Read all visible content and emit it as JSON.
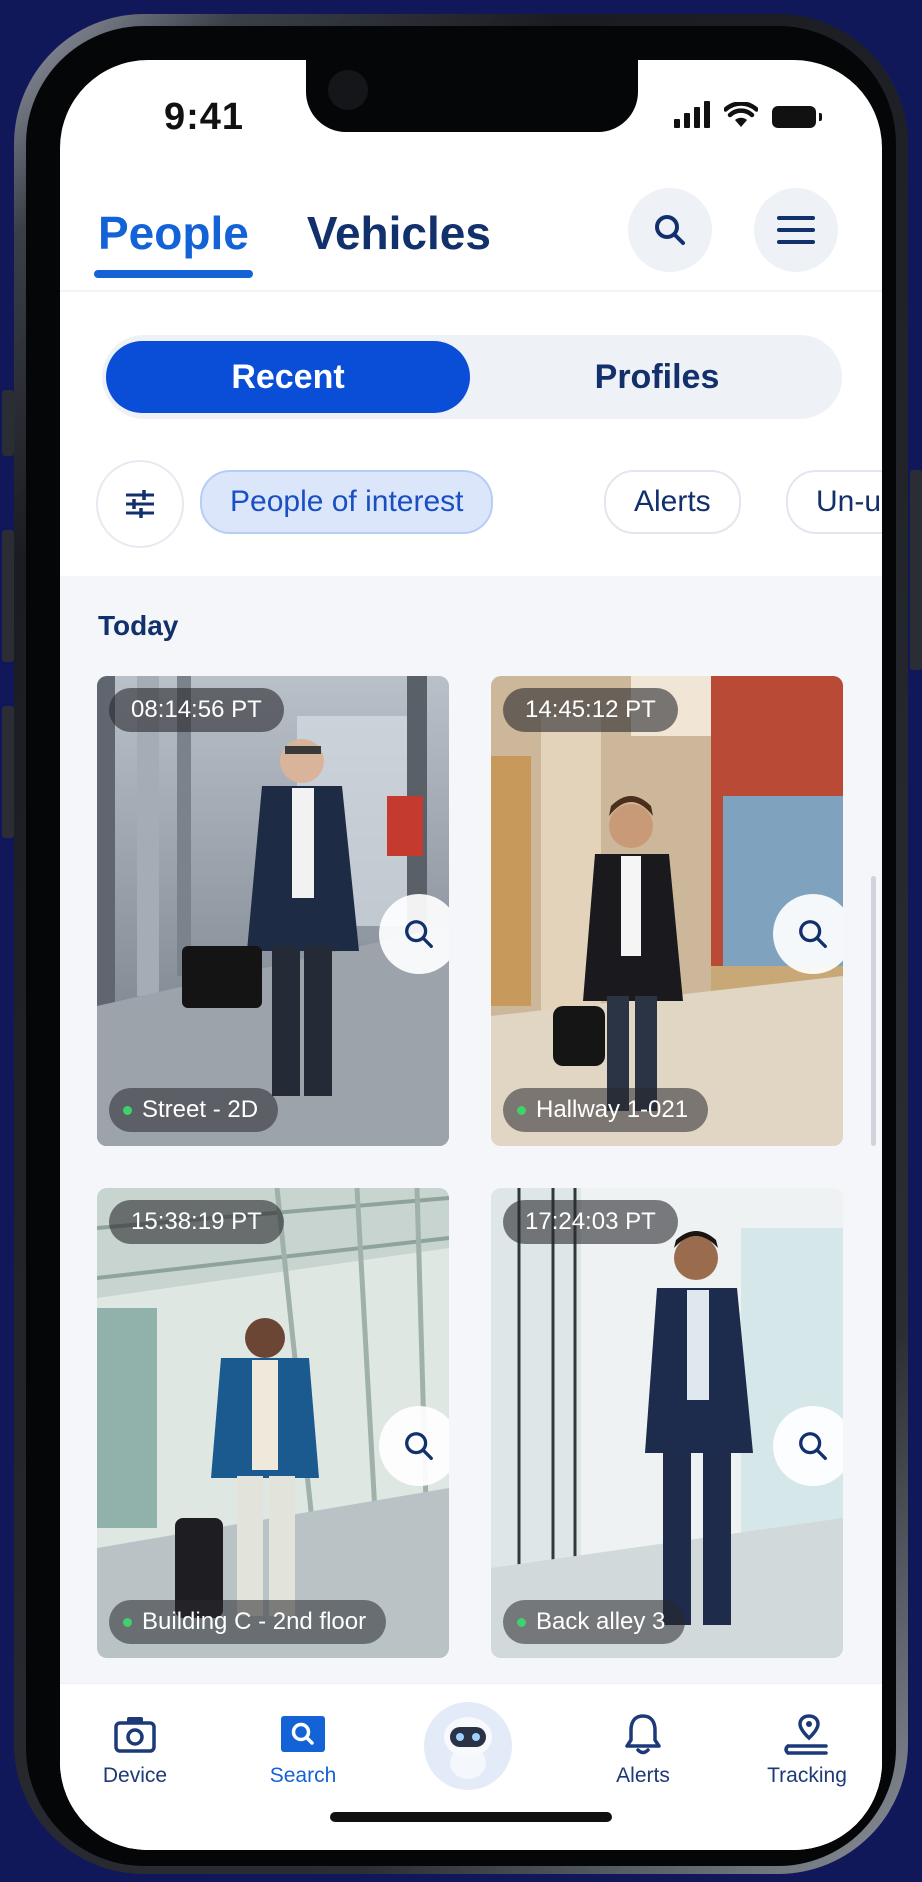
{
  "status_bar": {
    "time": "9:41"
  },
  "header": {
    "tabs": [
      {
        "label": "People",
        "active": true
      },
      {
        "label": "Vehicles",
        "active": false
      }
    ],
    "search_icon": "search-icon",
    "menu_icon": "hamburger-menu-icon"
  },
  "segmented": {
    "recent": "Recent",
    "profiles": "Profiles",
    "selected": "Recent"
  },
  "filters": {
    "filter_icon": "sliders-icon",
    "chips": [
      {
        "label": "People of interest",
        "selected": true
      },
      {
        "label": "Alerts",
        "selected": false
      },
      {
        "label": "Un-usual",
        "selected": false
      }
    ]
  },
  "section": {
    "title": "Today"
  },
  "cards": [
    {
      "time": "08:14:56 PT",
      "location": "Street - 2D"
    },
    {
      "time": "14:45:12 PT",
      "location": "Hallway 1-021"
    },
    {
      "time": "15:38:19 PT",
      "location": "Building C - 2nd floor"
    },
    {
      "time": "17:24:03 PT",
      "location": "Back alley 3"
    }
  ],
  "bottom_nav": {
    "items": [
      {
        "label": "Device",
        "icon": "camera-icon",
        "active": false
      },
      {
        "label": "Search",
        "icon": "search-icon",
        "active": true
      },
      {
        "label": "",
        "icon": "robot-assistant-icon",
        "active": false
      },
      {
        "label": "Alerts",
        "icon": "bell-icon",
        "active": false
      },
      {
        "label": "Tracking",
        "icon": "location-pin-icon",
        "active": false
      }
    ]
  },
  "colors": {
    "primary": "#0a4ed8",
    "accent": "#1463d6",
    "navy": "#12306b",
    "background": "#10185a"
  }
}
